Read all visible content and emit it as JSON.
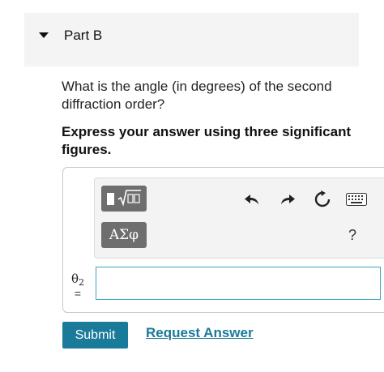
{
  "part": {
    "title": "Part B"
  },
  "question": {
    "text": "What is the angle (in degrees) of the second diffraction order?",
    "instruction": "Express your answer using three significant figures."
  },
  "toolbar": {
    "greek_label": "ΑΣφ",
    "help_label": "?",
    "icons": [
      "template-icon",
      "undo-icon",
      "redo-icon",
      "reset-icon",
      "keyboard-icon"
    ]
  },
  "answer": {
    "variable": "θ",
    "subscript": "2",
    "equals": "=",
    "value": ""
  },
  "actions": {
    "submit_label": "Submit",
    "request_label": "Request Answer"
  },
  "colors": {
    "accent": "#1a7a99",
    "input_border": "#3ca6c0",
    "toolbar_button": "#6e6e6e"
  }
}
